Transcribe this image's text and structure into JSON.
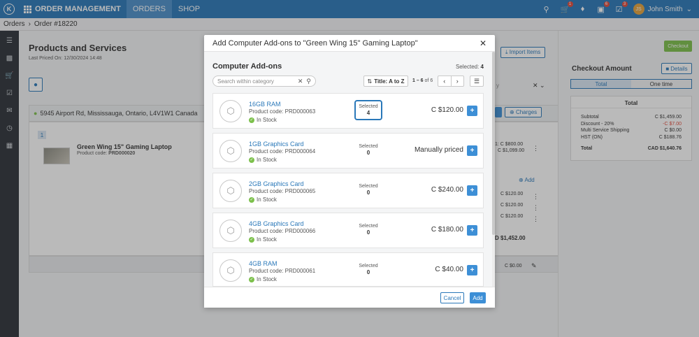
{
  "topbar": {
    "logo": "K",
    "app_title": "ORDER MANAGEMENT",
    "nav": [
      "ORDERS",
      "SHOP"
    ],
    "badges": {
      "cart": "1",
      "box": "6",
      "tasks": "3"
    },
    "avatar_initials": "JS",
    "user_name": "John Smith",
    "icons": [
      "search-icon",
      "cart-icon",
      "bell-icon",
      "box-icon",
      "tasks-icon",
      "chevron-down-icon"
    ]
  },
  "breadcrumb": {
    "root": "Orders",
    "current": "Order #18220"
  },
  "sidebar": {
    "icons": [
      "menu-icon",
      "document-icon",
      "cart-icon",
      "clipboard-icon",
      "chat-icon",
      "clock-icon",
      "calendar-icon"
    ]
  },
  "page": {
    "title": "Products and Services",
    "last_priced_label": "Last Priced On:",
    "last_priced_value": "12/30/2024 14:48",
    "address": "5945 Airport Rd, Mississauga, Ontario, L4V1W1 Canada",
    "item_number": "1",
    "item_name": "Green Wing 15\" Gaming Laptop",
    "item_code_label": "Product code:",
    "item_code": "PRD000020",
    "import_items": "Import Items",
    "charges": "Charges",
    "add": "Add",
    "bg_prices": [
      "1: C $800.00",
      "C $1,099.00",
      "C $120.00",
      "C $120.00",
      "C $120.00"
    ],
    "bg_total": "D $1,452.00",
    "bg_footer_price": "C $0.00",
    "bg_select_hint": "y"
  },
  "checkout": {
    "button": "Checkout",
    "title": "Checkout Amount",
    "details": "Details",
    "tabs": [
      "Total",
      "One time"
    ],
    "card_title": "Total",
    "rows": [
      {
        "label": "Subtotal",
        "value": "C $1,459.00"
      },
      {
        "label": "Discount - 20%",
        "value": "-C $7.00"
      },
      {
        "label": "Multi Service Shipping",
        "value": "C $0.00"
      },
      {
        "label": "HST (ON)",
        "value": "C $188.76"
      }
    ],
    "total_label": "Total",
    "total_value": "CAD $1,640.76"
  },
  "modal": {
    "title": "Add Computer Add-ons to \"Green Wing 15\" Gaming Laptop\"",
    "section": "Computer Add-ons",
    "selected_label": "Selected:",
    "selected_value": "4",
    "search_placeholder": "Search within category",
    "sort": "Title: A to Z",
    "pager_text": "1 – 6",
    "pager_of": "of 6",
    "cancel": "Cancel",
    "add": "Add",
    "selected_word": "Selected",
    "code_label": "Product code:",
    "in_stock": "In Stock",
    "products": [
      {
        "name": "16GB RAM",
        "code": "PRD000063",
        "selected": "4",
        "price": "C $120.00"
      },
      {
        "name": "1GB Graphics Card",
        "code": "PRD000064",
        "selected": "0",
        "price": "Manually priced"
      },
      {
        "name": "2GB Graphics Card",
        "code": "PRD000065",
        "selected": "0",
        "price": "C $240.00"
      },
      {
        "name": "4GB Graphics Card",
        "code": "PRD000066",
        "selected": "0",
        "price": "C $180.00"
      },
      {
        "name": "4GB RAM",
        "code": "PRD000061",
        "selected": "0",
        "price": "C $40.00"
      }
    ]
  },
  "colors": {
    "primary": "#2a78b9",
    "accent_green": "#7cc04b",
    "danger": "#e24a3b"
  }
}
